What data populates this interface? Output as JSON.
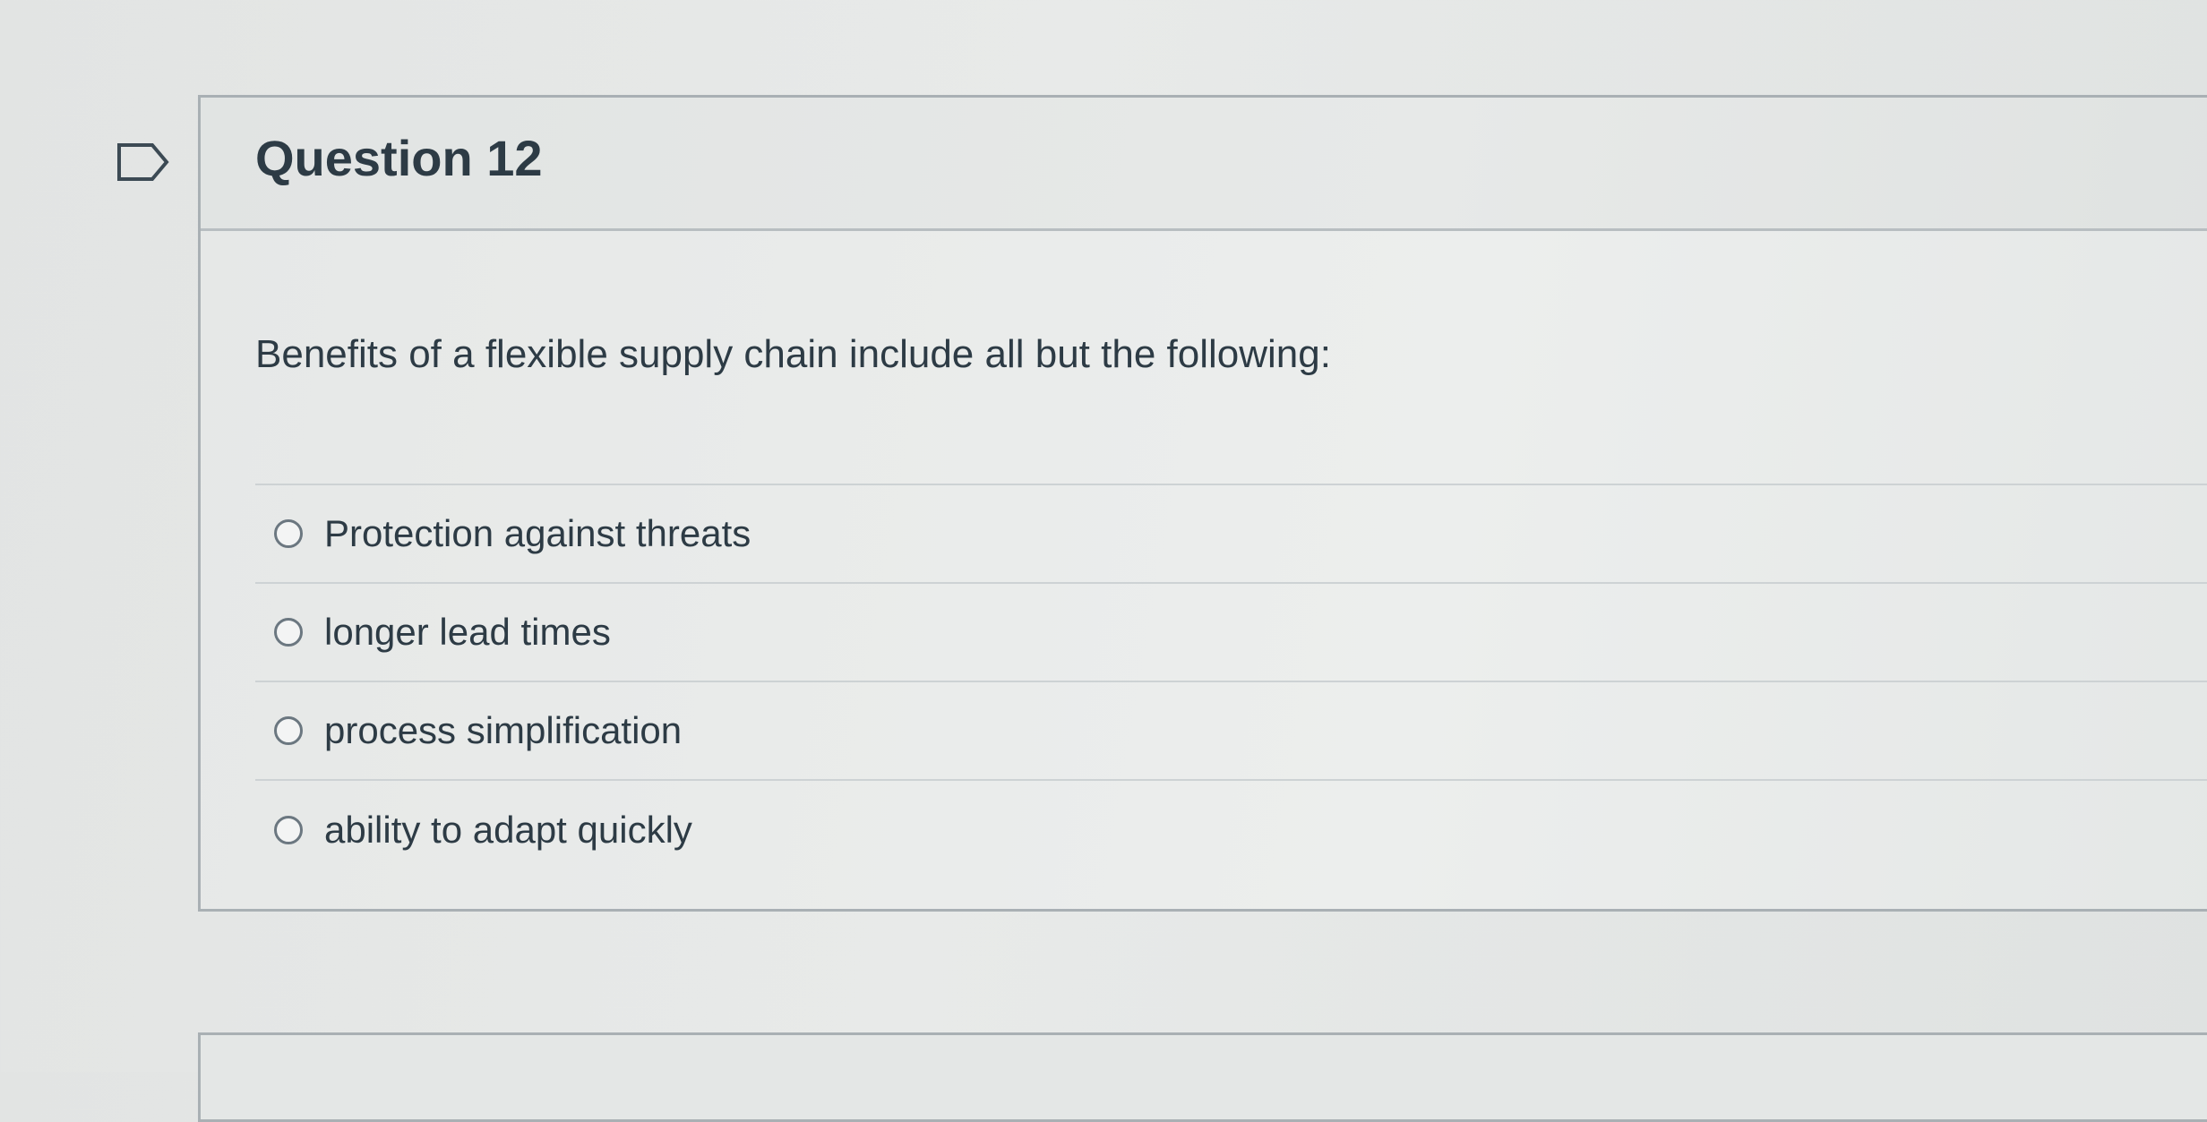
{
  "question": {
    "title": "Question 12",
    "text": "Benefits of a flexible supply chain include all but the following:",
    "answers": [
      {
        "label": "Protection against threats"
      },
      {
        "label": "longer lead times"
      },
      {
        "label": "process simplification"
      },
      {
        "label": "ability to adapt quickly"
      }
    ]
  },
  "icons": {
    "flag": "flag-question-icon",
    "radio": "radio-button-unselected"
  },
  "colors": {
    "text": "#2d3b45",
    "border": "#a9b0b4",
    "background": "#e6e8e7"
  }
}
